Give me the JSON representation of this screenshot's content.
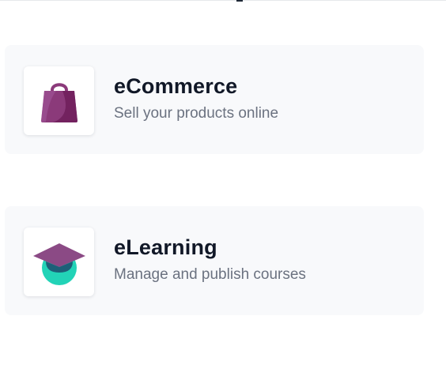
{
  "apps": [
    {
      "title": "eCommerce",
      "description": "Sell your products online",
      "icon": "shopping-bag-icon"
    },
    {
      "title": "eLearning",
      "description": "Manage and publish courses",
      "icon": "graduation-cap-icon"
    }
  ],
  "colors": {
    "card_background": "#f8f9fb",
    "title": "#111827",
    "subtitle": "#6b7280",
    "bag_purple": "#8b3a7a",
    "cap_purple": "#8b4a85",
    "cap_teal": "#22d3b7"
  }
}
